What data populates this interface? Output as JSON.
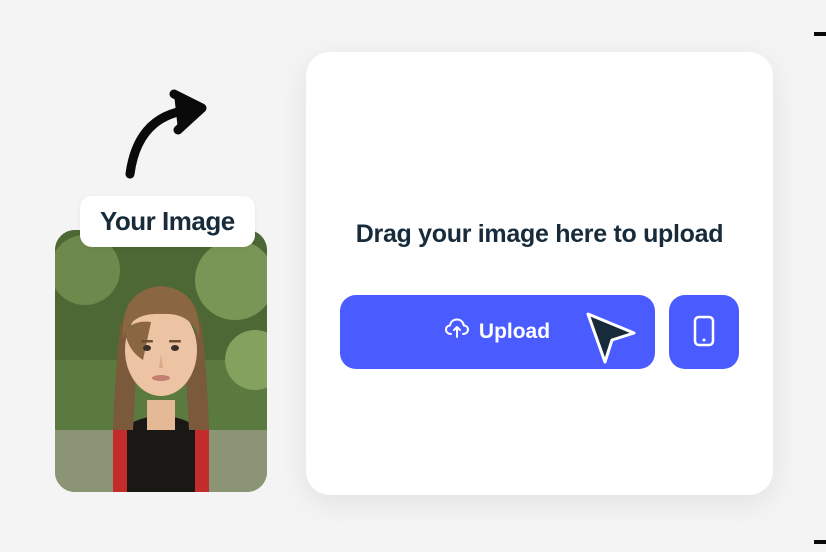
{
  "your_image_label": "Your Image",
  "upload_card": {
    "drag_text": "Drag  your image here to upload",
    "upload_button_label": "Upload"
  },
  "icons": {
    "arrow": "arrow-icon",
    "cloud_upload": "cloud-upload-icon",
    "mobile": "mobile-icon",
    "cursor": "cursor-icon"
  },
  "colors": {
    "accent": "#4a5cff",
    "text_dark": "#172b3a"
  }
}
